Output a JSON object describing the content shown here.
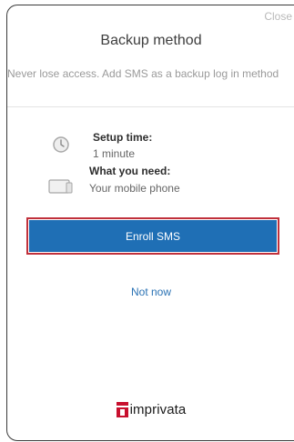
{
  "dialog": {
    "close_label": "Close",
    "title": "Backup method",
    "description": "Never lose access. Add SMS as a backup log in method"
  },
  "info": {
    "setup_time_label": "Setup time:",
    "setup_time_value": "1 minute",
    "need_label": "What you need:",
    "need_value": "Your mobile phone",
    "icons": [
      "clock-icon",
      "device-icon"
    ]
  },
  "actions": {
    "enroll_label": "Enroll SMS",
    "not_now_label": "Not now"
  },
  "footer": {
    "brand": "imprivata",
    "brand_color": "#c8102e"
  },
  "colors": {
    "primary": "#1f6fb5",
    "highlight": "#c0303b",
    "link": "#2a72b4"
  }
}
